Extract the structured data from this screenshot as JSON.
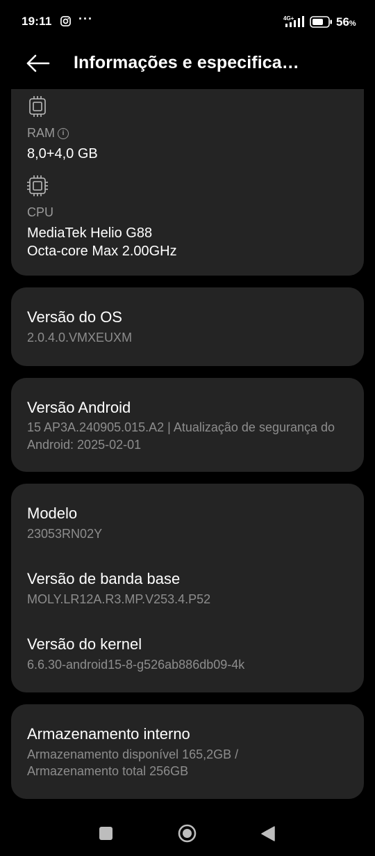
{
  "status_bar": {
    "time": "19:11",
    "network": "4G+",
    "battery_percent": "56",
    "battery_unit": "%",
    "notification_icons": [
      "instagram-icon",
      "more-dots-icon"
    ]
  },
  "header": {
    "title": "Informações e especifica…",
    "back_icon": "arrow-left-icon"
  },
  "specs": {
    "ram_label": "RAM",
    "ram_value": "8,0+4,0 GB",
    "cpu_label": "CPU",
    "cpu_value_1": "MediaTek Helio G88",
    "cpu_value_2": "Octa-core Max 2.00GHz"
  },
  "os": {
    "title": "Versão do OS",
    "value": "2.0.4.0.VMXEUXM"
  },
  "android": {
    "title": "Versão Android",
    "value": "15 AP3A.240905.015.A2 | Atualização de segurança do Android: 2025-02-01"
  },
  "model": {
    "model_title": "Modelo",
    "model_value": "23053RN02Y",
    "baseband_title": "Versão de banda base",
    "baseband_value": "MOLY.LR12A.R3.MP.V253.4.P52",
    "kernel_title": "Versão do kernel",
    "kernel_value": "6.6.30-android15-8-g526ab886db09-4k"
  },
  "storage": {
    "title": "Armazenamento interno",
    "line1": "Armazenamento disponível  165,2GB /",
    "line2": "Armazenamento total  256GB"
  },
  "colors": {
    "background": "#000000",
    "card": "#242424",
    "secondary_text": "#9a9a9a"
  }
}
